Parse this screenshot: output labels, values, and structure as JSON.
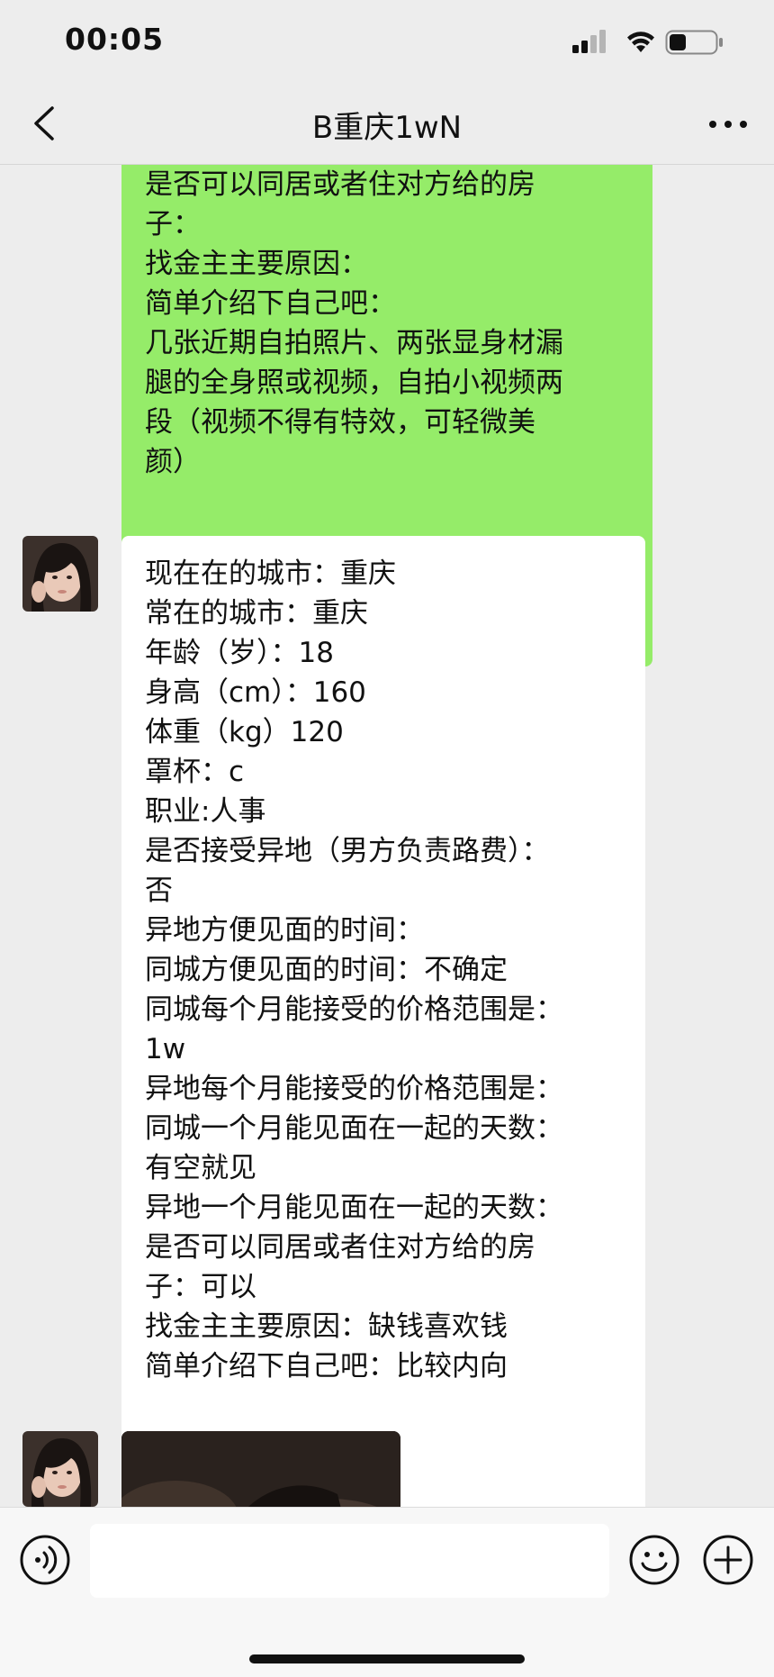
{
  "status_bar": {
    "time": "00:05",
    "battery_level": 0.35
  },
  "nav": {
    "title": "B重庆1wN"
  },
  "messages": {
    "outgoing_lines": [
      "是否可以同居或者住对方给的房",
      "子：",
      "找金主主要原因：",
      "简单介绍下自己吧：",
      "几张近期自拍照片、两张显身材漏",
      "腿的全身照或视频，自拍小视频两",
      "段（视频不得有特效，可轻微美",
      "颜）"
    ],
    "incoming_lines": [
      "现在在的城市：重庆",
      "常在的城市：重庆",
      "年龄（岁）：18",
      "身高（cm）：160",
      "体重（kg）120",
      "罩杯：c",
      "职业:人事",
      "是否接受异地（男方负责路费）：",
      "否",
      "异地方便见面的时间：",
      "同城方便见面的时间：不确定",
      "同城每个月能接受的价格范围是：",
      "1w",
      "异地每个月能接受的价格范围是：",
      "同城一个月能见面在一起的天数：",
      "有空就见",
      "异地一个月能见面在一起的天数：",
      "是否可以同居或者住对方给的房",
      "子：可以",
      "找金主主要原因：缺钱喜欢钱",
      "简单介绍下自己吧：比较内向"
    ]
  },
  "input": {
    "placeholder": ""
  },
  "colors": {
    "outgoing_bubble": "#95ec69",
    "incoming_bubble": "#ffffff",
    "background": "#ededed"
  }
}
